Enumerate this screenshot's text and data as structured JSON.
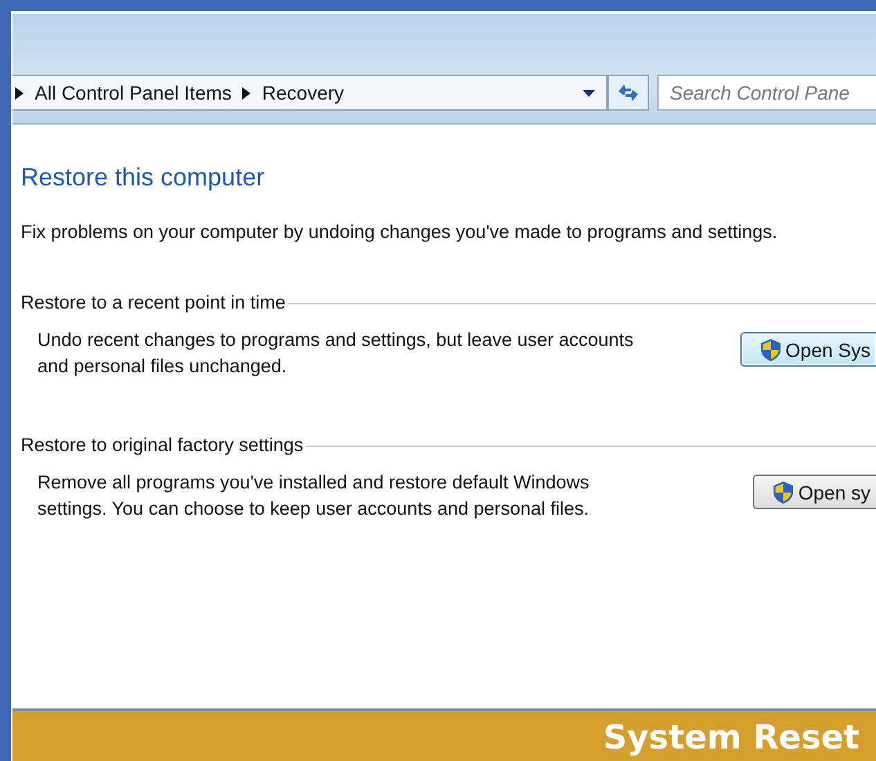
{
  "address_bar": {
    "path": [
      {
        "label": "All Control Panel Items"
      },
      {
        "label": "Recovery"
      }
    ]
  },
  "search": {
    "placeholder": "Search Control Pane"
  },
  "title": "Restore this computer",
  "description": "Fix problems on your computer by undoing changes you've made to programs and settings.",
  "sections": [
    {
      "heading": "Restore to a recent point in time",
      "text": "Undo recent changes to programs and settings, but leave user accounts and personal files unchanged.",
      "button": "Open Sys",
      "focused": true
    },
    {
      "heading": "Restore to original factory settings",
      "text": "Remove all programs you've installed and restore default Windows settings. You can choose to keep user accounts and personal files.",
      "button": "Open sy",
      "focused": false
    }
  ],
  "caption": "System Reset"
}
